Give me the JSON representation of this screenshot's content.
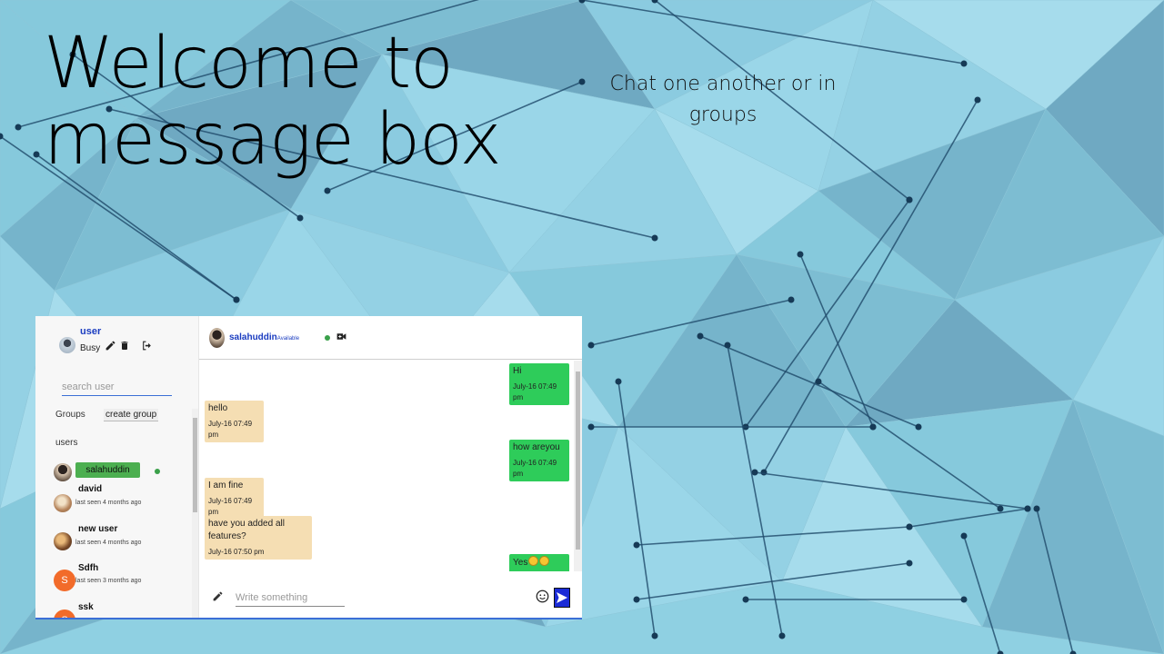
{
  "slide": {
    "headline": "Welcome to message box",
    "tagline": "Chat one another or in groups"
  },
  "sidebar": {
    "me": {
      "name": "user",
      "status": "Busy"
    },
    "search": {
      "placeholder": "search user",
      "value": ""
    },
    "groups_label": "Groups",
    "create_group": "create group",
    "users_label": "users",
    "users": [
      {
        "name": "salahuddin",
        "active": true,
        "online": true
      },
      {
        "name": "david",
        "last_seen": "last seen 4 months ago"
      },
      {
        "name": "new user",
        "last_seen": "last seen 4 months ago"
      },
      {
        "name": "Sdfh",
        "last_seen": "last seen 3 months ago",
        "initial": "S"
      },
      {
        "name": "ssk",
        "initial": "S"
      }
    ]
  },
  "chat": {
    "contact": {
      "name": "salahuddin",
      "status": "Available",
      "online": true
    },
    "messages": [
      {
        "dir": "sent",
        "text": "Hi",
        "time": "July-16 07:49 pm"
      },
      {
        "dir": "recv",
        "text": "hello",
        "time": "July-16 07:49 pm"
      },
      {
        "dir": "sent",
        "text": "how areyou",
        "time": "July-16 07:49 pm"
      },
      {
        "dir": "recv",
        "text": "I am fine",
        "time": "July-16 07:49 pm"
      },
      {
        "dir": "recv",
        "text": "have you added all features?",
        "time": "July-16 07:50 pm"
      },
      {
        "dir": "sent",
        "text": "Yes",
        "emoji": [
          "blush-emoji",
          "blush-emoji"
        ]
      }
    ],
    "composer": {
      "placeholder": "Write something",
      "value": ""
    }
  },
  "colors": {
    "background": "#8fd0e2",
    "sent_bubble": "#2ecc5a",
    "received_bubble": "#f5deb3",
    "active_pill": "#4caf50",
    "link_blue": "#1a3cc0",
    "send_button": "#1a2bd6",
    "avatar_orange": "#f26b2a"
  },
  "icons": [
    "pencil-icon",
    "trash-icon",
    "logout-icon",
    "video-camera-icon",
    "smiley-icon",
    "send-icon"
  ]
}
